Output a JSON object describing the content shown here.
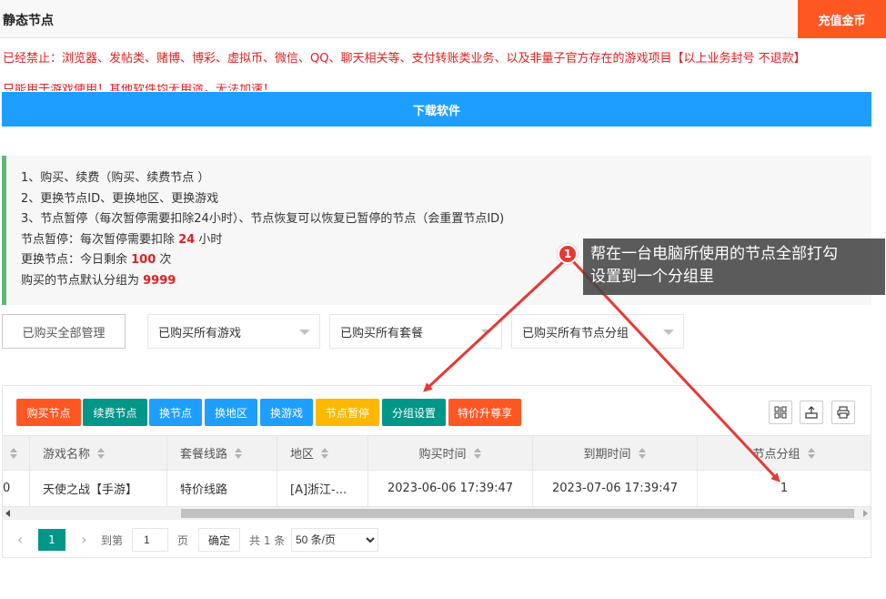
{
  "header": {
    "title": "静态节点",
    "recharge_label": "充值金币"
  },
  "notice": {
    "line1": "已经禁止：浏览器、发帖类、赌博、博彩、虚拟币、微信、QQ、聊天相关等、支付转账类业务、以及非量子官方存在的游戏项目【以上业务封号 不退款】",
    "line2": "只能用于游戏使用！其他软件均无用途，无法加速！"
  },
  "download_label": "下载软件",
  "info": {
    "line1": "1、购买、续费（购买、续费节点 ）",
    "line2": "2、更换节点ID、更换地区、更换游戏",
    "line3": "3、节点暂停（每次暂停需要扣除24小时）、节点恢复可以恢复已暂停的节点（会重置节点ID)",
    "pause_prefix": "节点暂停：每次暂停需要扣除 ",
    "pause_hours": "24",
    "pause_suffix": " 小时",
    "change_prefix": "更换节点：今日剩余 ",
    "change_count": "100",
    "change_suffix": " 次",
    "group_prefix": "购买的节点默认分组为 ",
    "group_default": "9999"
  },
  "filters": {
    "manage_label": "已购买全部管理",
    "games": "已购买所有游戏",
    "plans": "已购买所有套餐",
    "groups": "已购买所有节点分组"
  },
  "toolbar": {
    "buy": "购买节点",
    "renew": "续费节点",
    "change_node": "换节点",
    "change_region": "换地区",
    "change_game": "换游戏",
    "pause": "节点暂停",
    "group_set": "分组设置",
    "upgrade": "特价升尊享"
  },
  "colors": {
    "orange": "#ff5722",
    "green": "#009688",
    "blue": "#1e9fff",
    "yellow": "#ffb800",
    "badge_red": "#e53935"
  },
  "table": {
    "columns": [
      "游戏名称",
      "套餐线路",
      "地区",
      "购买时间",
      "到期时间",
      "节点分组"
    ],
    "rows": [
      {
        "id": "0",
        "game": "天使之战【手游】",
        "plan": "特价线路",
        "region": "[A]浙江-...",
        "buy_time": "2023-06-06 17:39:47",
        "expire_time": "2023-07-06 17:39:47",
        "group": "1"
      }
    ]
  },
  "pager": {
    "current": "1",
    "goto_label": "到第",
    "goto_value": "1",
    "page_unit": "页",
    "confirm": "确定",
    "total": "共 1 条",
    "page_size": "50 条/页"
  },
  "annotation": {
    "badge": "1",
    "text_line1": "帮在一台电脑所使用的节点全部打勾",
    "text_line2": "设置到一个分组里"
  }
}
